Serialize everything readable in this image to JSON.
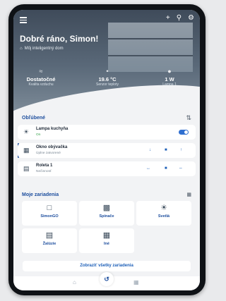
{
  "header": {
    "greeting": "Dobré ráno, Simon!",
    "home_name": "Môj inteligentný dom",
    "icons": [
      "plus-icon",
      "search-icon",
      "settings-icon"
    ]
  },
  "stats": [
    {
      "value": "Dostatočné",
      "label": "Kvalita vzduchu",
      "icon": "air-quality-icon"
    },
    {
      "value": "19.6 °C",
      "label": "Senzor teploty",
      "icon": "thermometer-icon"
    },
    {
      "value": "1 W",
      "label": "Lampa 1",
      "icon": "lamp-icon"
    }
  ],
  "favorites": {
    "title": "Obľúbené",
    "items": [
      {
        "name": "Lampa kuchyňa",
        "status": "On",
        "icon": "lamp-icon"
      },
      {
        "name": "Okno obývačka",
        "status": "Úplne zatvorené",
        "icon": "window-icon"
      },
      {
        "name": "Roleta 1",
        "status": "Nečinnosť",
        "icon": "blind-icon"
      }
    ]
  },
  "devices": {
    "title": "Moje zariadenia",
    "tiles": [
      {
        "label": "SimonGO",
        "icon": "hub-icon"
      },
      {
        "label": "Spínače",
        "icon": "switch-icon"
      },
      {
        "label": "Svetlá",
        "icon": "light-icon"
      },
      {
        "label": "Žalúzie",
        "icon": "blinds-icon"
      },
      {
        "label": "Iné",
        "icon": "grid-icon"
      }
    ],
    "show_all": "Zobraziť všetky zariadenia"
  },
  "colors": {
    "accent": "#1d4e9e",
    "toggle": "#2f6fd0",
    "on_status": "#2e9e44"
  }
}
